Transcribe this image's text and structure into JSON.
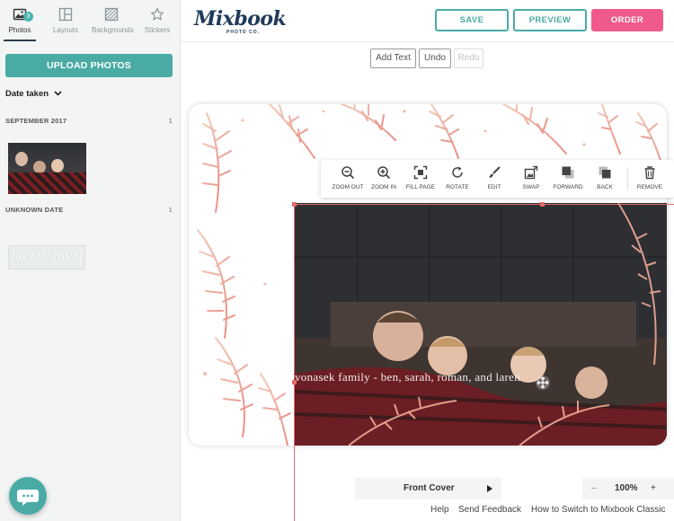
{
  "sidebar": {
    "tabs": [
      {
        "label": "Photos",
        "icon": "photos-icon",
        "badge": "3",
        "active": true
      },
      {
        "label": "Layouts",
        "icon": "layouts-icon"
      },
      {
        "label": "Backgrounds",
        "icon": "backgrounds-icon"
      },
      {
        "label": "Stickers",
        "icon": "star-icon"
      }
    ],
    "upload_label": "UPLOAD PHOTOS",
    "sort_label": "Date taken",
    "groups": [
      {
        "title": "SEPTEMBER 2017",
        "count": "1"
      },
      {
        "title": "UNKNOWN DATE",
        "count": "1"
      }
    ],
    "text_thumb": "merry merry"
  },
  "header": {
    "logo": "Mixbook",
    "logo_sub": "PHOTO CO.",
    "save_label": "SAVE",
    "preview_label": "PREVIEW",
    "order_label": "ORDER"
  },
  "edit_toolbar": {
    "add_text": "Add Text",
    "undo": "Undo",
    "redo": "Redo"
  },
  "photo_tools": [
    {
      "label": "ZOOM OUT",
      "icon": "zoom-out-icon"
    },
    {
      "label": "ZOOM IN",
      "icon": "zoom-in-icon"
    },
    {
      "label": "FILL PAGE",
      "icon": "fill-page-icon"
    },
    {
      "label": "ROTATE",
      "icon": "rotate-icon"
    },
    {
      "label": "EDIT",
      "icon": "edit-brush-icon"
    },
    {
      "label": "SWAP",
      "icon": "swap-icon"
    },
    {
      "label": "FORWARD",
      "icon": "forward-icon"
    },
    {
      "label": "BACK",
      "icon": "back-icon"
    },
    {
      "label": "REMOVE",
      "icon": "trash-icon"
    }
  ],
  "canvas": {
    "card_text": "vonasek family  -  ben, sarah, roman, and laren"
  },
  "footer": {
    "page_label": "Front Cover",
    "zoom_minus": "–",
    "zoom_value": "100%",
    "zoom_plus": "+",
    "links": [
      "Help",
      "Send Feedback",
      "How to Switch to Mixbook Classic"
    ]
  },
  "colors": {
    "accent": "#4aaba5",
    "order": "#f05a8a",
    "selection": "#e36a6a",
    "logo": "#1f3a5a"
  }
}
